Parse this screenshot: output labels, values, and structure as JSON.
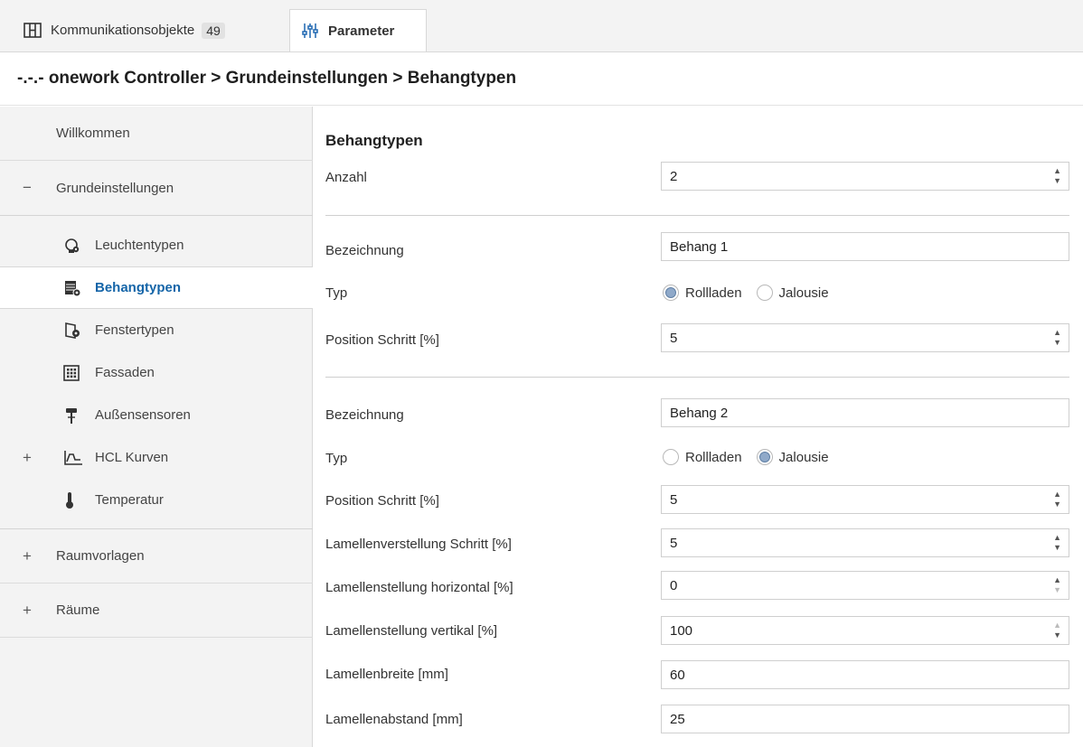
{
  "tabs": {
    "kommunikation": {
      "label": "Kommunikationsobjekte",
      "count": "49",
      "icon": "comm-objects-icon"
    },
    "parameter": {
      "label": "Parameter",
      "icon": "parameter-sliders-icon"
    }
  },
  "breadcrumb": "-.-.- onework Controller > Grundeinstellungen > Behangtypen",
  "sidebar": {
    "willkommen": "Willkommen",
    "grundeinstellungen": {
      "sign": "−",
      "label": "Grundeinstellungen"
    },
    "sub_items": [
      {
        "label": "Leuchtentypen",
        "icon": "lamp-gear-icon"
      },
      {
        "label": "Behangtypen",
        "icon": "blind-gear-icon"
      },
      {
        "label": "Fenstertypen",
        "icon": "window-gear-icon"
      },
      {
        "label": "Fassaden",
        "icon": "facade-grid-icon"
      },
      {
        "label": "Außensensoren",
        "icon": "outdoor-sensor-icon"
      },
      {
        "label": "HCL Kurven",
        "icon": "curve-chart-icon",
        "sign": "+"
      },
      {
        "label": "Temperatur",
        "icon": "thermometer-icon"
      }
    ],
    "raumvorlagen": {
      "sign": "+",
      "label": "Raumvorlagen"
    },
    "raeume": {
      "sign": "+",
      "label": "Räume"
    }
  },
  "main": {
    "title": "Behangtypen",
    "anzahl": {
      "label": "Anzahl",
      "value": "2"
    },
    "behang1": {
      "bezeichnung_label": "Bezeichnung",
      "bezeichnung_value": "Behang 1",
      "typ_label": "Typ",
      "option_rollladen": "Rollladen",
      "option_jalousie": "Jalousie",
      "selected": "Rollladen",
      "position_label": "Position Schritt [%]",
      "position_value": "5"
    },
    "behang2": {
      "bezeichnung_label": "Bezeichnung",
      "bezeichnung_value": "Behang 2",
      "typ_label": "Typ",
      "option_rollladen": "Rollladen",
      "option_jalousie": "Jalousie",
      "selected": "Jalousie",
      "position_label": "Position Schritt [%]",
      "position_value": "5",
      "lamellenverstellung_label": "Lamellenverstellung Schritt [%]",
      "lamellenverstellung_value": "5",
      "lamellen_horizontal_label": "Lamellenstellung horizontal [%]",
      "lamellen_horizontal_value": "0",
      "lamellen_vertikal_label": "Lamellenstellung vertikal [%]",
      "lamellen_vertikal_value": "100",
      "lamellenbreite_label": "Lamellenbreite [mm]",
      "lamellenbreite_value": "60",
      "lamellenabstand_label": "Lamellenabstand [mm]",
      "lamellenabstand_value": "25"
    }
  },
  "colors": {
    "active_text": "#1565a8",
    "sidebar_bg": "#f3f3f3",
    "radio_selected": "#8fa9c9"
  }
}
